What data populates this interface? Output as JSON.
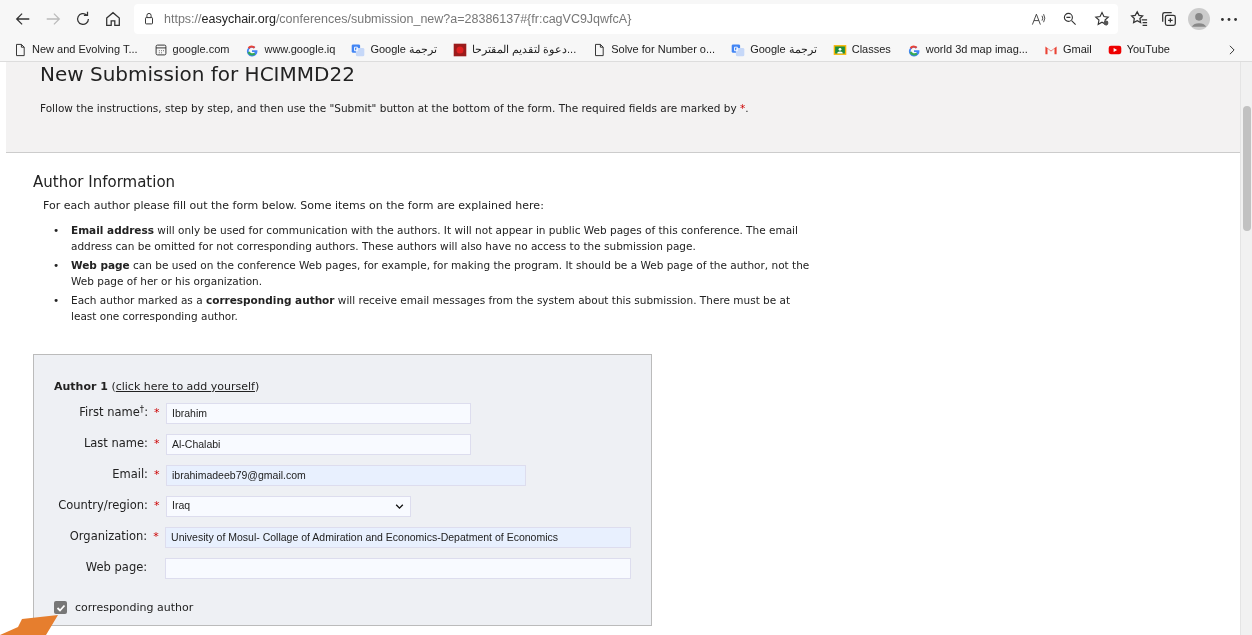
{
  "browser": {
    "url_prefix": "https://",
    "url_host": "easychair.org",
    "url_path": "/conferences/submission_new?a=28386137#{fr:cagVC9JqwfcA}",
    "back_enabled": true,
    "forward_enabled": false
  },
  "bookmarks": [
    {
      "kind": "page",
      "label": "New and Evolving T..."
    },
    {
      "kind": "calendar",
      "label": "google.com"
    },
    {
      "kind": "google",
      "label": "www.google.iq"
    },
    {
      "kind": "translate",
      "label": "Google ترجمة"
    },
    {
      "kind": "image",
      "label": "دعوة لتقديم المقترحا..."
    },
    {
      "kind": "page",
      "label": "Solve for Number o..."
    },
    {
      "kind": "translate",
      "label": "Google ترجمة"
    },
    {
      "kind": "classroom",
      "label": "Classes"
    },
    {
      "kind": "google",
      "label": "world 3d map imag..."
    },
    {
      "kind": "gmail",
      "label": "Gmail"
    },
    {
      "kind": "youtube",
      "label": "YouTube"
    }
  ],
  "header": {
    "title": "New Submission for HCIMMD22",
    "instructions": "Follow the instructions, step by step, and then use the \"Submit\" button at the bottom of the form. The required fields are marked by",
    "required_mark": "*",
    "instructions_end": "."
  },
  "author_info": {
    "heading": "Author Information",
    "intro": "For each author please fill out the form below. Some items on the form are explained here:",
    "bullets": [
      {
        "marker": "•",
        "text": "**Email address** will only be used for communication with the authors. It will not appear in public Web pages of this conference. The email address can be omitted for not corresponding authors. These authors will also have no access to the submission page."
      },
      {
        "marker": "•",
        "text": "**Web page** can be used on the conference Web pages, for example, for making the program. It should be a Web page of the author, not the Web page of her or his organization."
      },
      {
        "marker": "•",
        "text": "Each author marked as a **corresponding author** will receive email messages from the system about this submission. There must be at least one corresponding author."
      }
    ]
  },
  "author_form": {
    "title": "Author 1",
    "link_open": "(",
    "link": "click here to add yourself",
    "link_close": ")",
    "fields": [
      {
        "kind": "text",
        "label": "First name$^{†}$:",
        "required": true,
        "value": "Ibrahim",
        "autofilled": false
      },
      {
        "kind": "text",
        "label": "Last name:",
        "required": true,
        "value": "Al-Chalabi",
        "autofilled": false
      },
      {
        "kind": "text",
        "label": "Email:",
        "required": true,
        "value": "ibrahimadeeb79@gmail.com",
        "autofilled": true
      },
      {
        "kind": "select",
        "label": "Country/region:",
        "required": true,
        "value": "Iraq",
        "autofilled": false
      },
      {
        "kind": "text",
        "label": "Organization:",
        "required": true,
        "value": "Univesity of Mosul- Collage of Admiration and Economics-Depatment of Economics",
        "autofilled": true
      },
      {
        "kind": "text",
        "label": "Web page:",
        "required": false,
        "autofilled": false
      }
    ],
    "corresponding": {
      "label": "corresponding author",
      "checked": true
    }
  }
}
